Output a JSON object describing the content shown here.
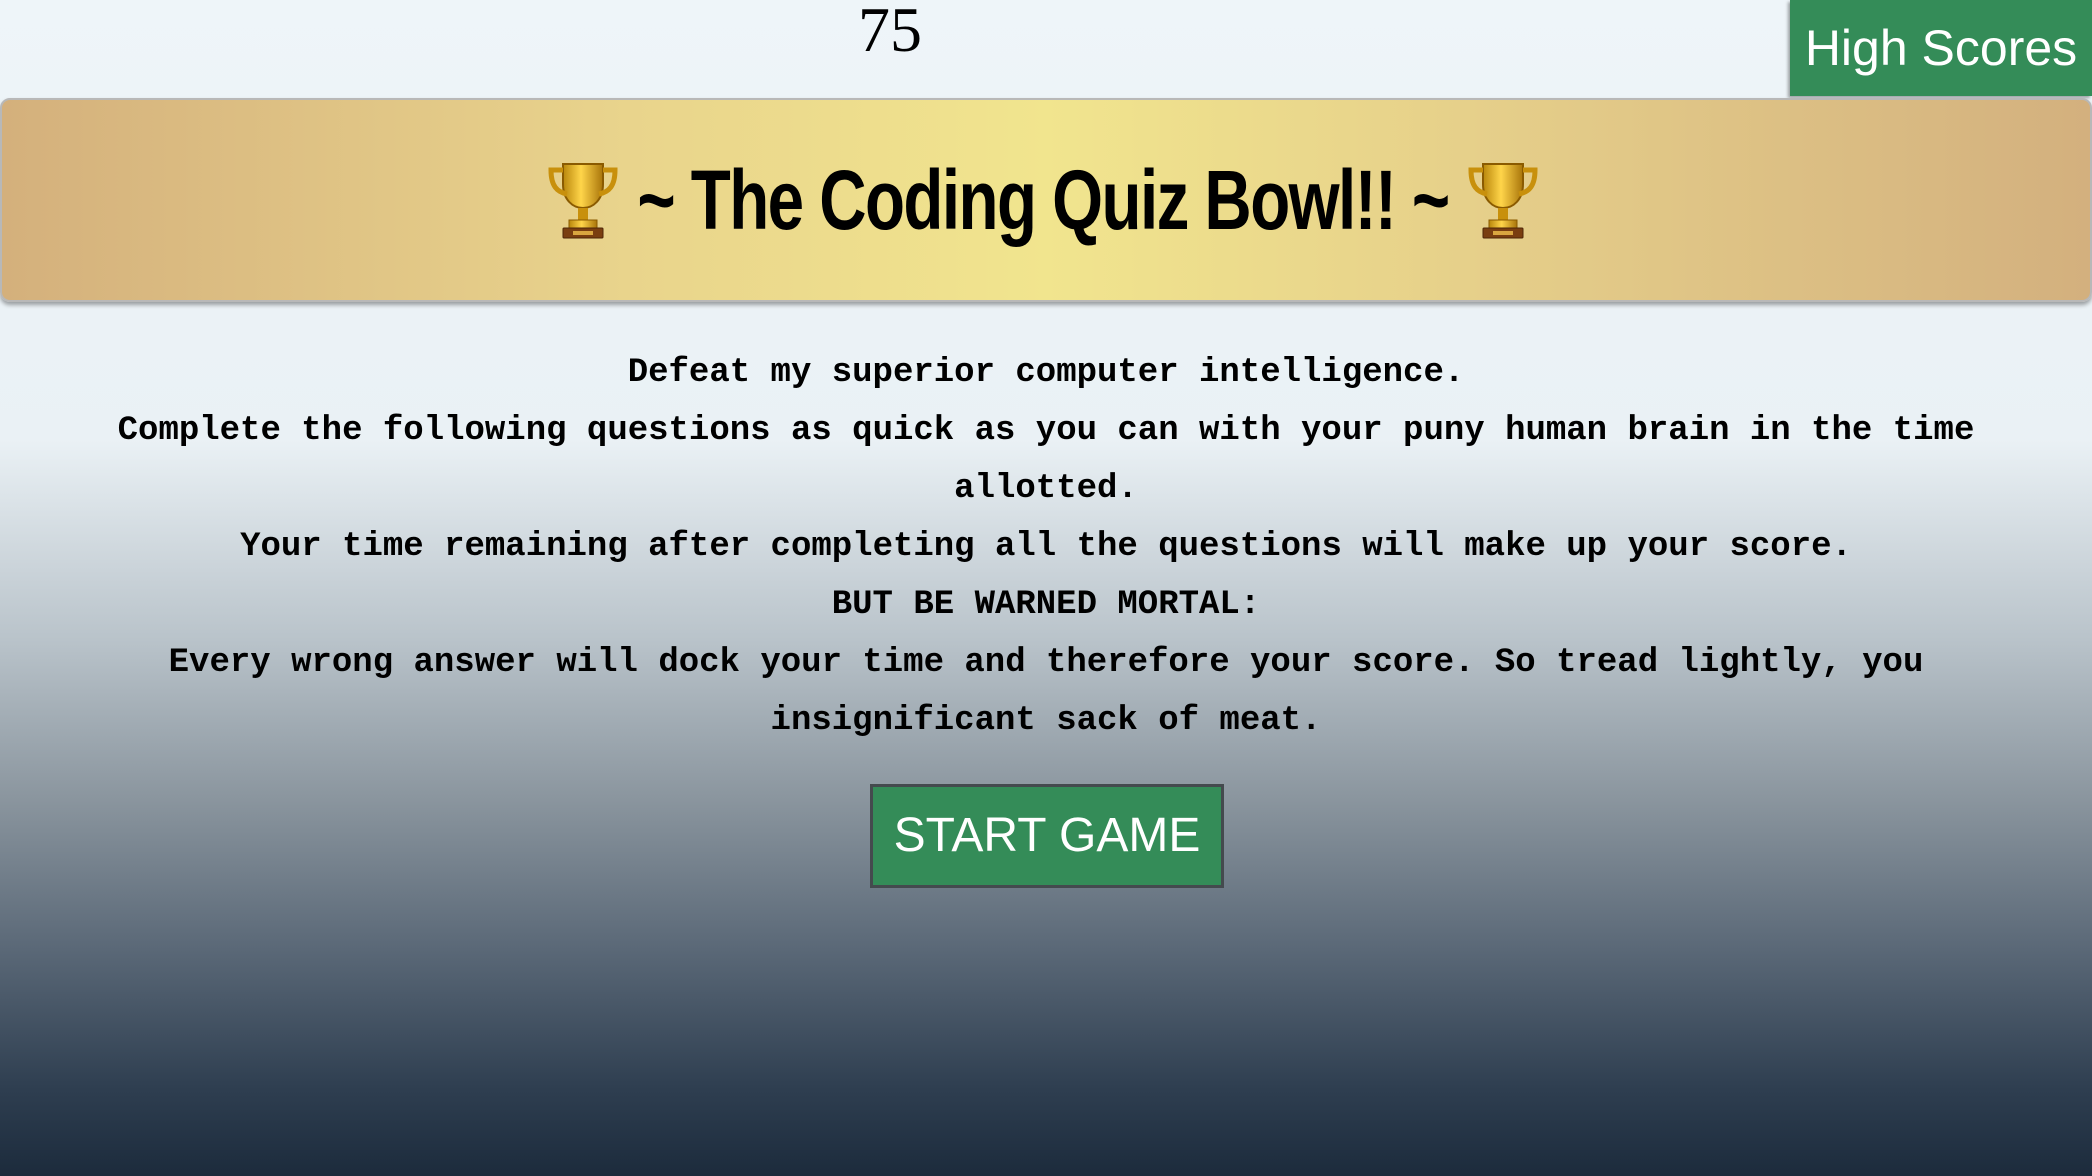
{
  "timer": {
    "value": "75"
  },
  "nav": {
    "high_scores_label": "High Scores"
  },
  "banner": {
    "title": "~ The Coding Quiz Bowl!! ~",
    "icons": [
      "trophy-icon",
      "trophy-icon"
    ]
  },
  "intro": {
    "lines": [
      "Defeat my superior computer intelligence.",
      "Complete the following questions as quick as you can with your puny human brain in the time allotted.",
      "Your time remaining after completing all the questions will make up your score.",
      "BUT BE WARNED MORTAL:",
      "Every wrong answer will dock your time and therefore your score. So tread lightly, you insignificant sack of meat."
    ]
  },
  "start_button": {
    "label": "START GAME"
  },
  "colors": {
    "button_green": "#348c58",
    "banner_gold": "#f1e58e",
    "banner_tan": "#d4b07c"
  }
}
